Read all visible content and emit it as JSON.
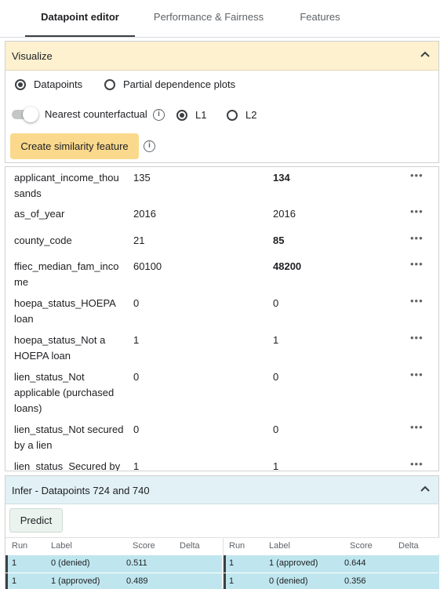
{
  "tabs": [
    {
      "label": "Datapoint editor"
    },
    {
      "label": "Performance & Fairness"
    },
    {
      "label": "Features"
    }
  ],
  "visualize": {
    "title": "Visualize",
    "radio_datapoints": "Datapoints",
    "radio_pdp": "Partial dependence plots",
    "nearest_label": "Nearest counterfactual",
    "l1": "L1",
    "l2": "L2",
    "similarity_button": "Create similarity feature"
  },
  "features": [
    {
      "name": "applicant_income_thousands",
      "v1": "135",
      "v2": "134",
      "v2_bold": true
    },
    {
      "name": "as_of_year",
      "v1": "2016",
      "v2": "2016",
      "v2_bold": false
    },
    {
      "name": "county_code",
      "v1": "21",
      "v2": "85",
      "v2_bold": true
    },
    {
      "name": "ffiec_median_fam_income",
      "v1": "60100",
      "v2": "48200",
      "v2_bold": true
    },
    {
      "name": "hoepa_status_HOEPA loan",
      "v1": "0",
      "v2": "0",
      "v2_bold": false
    },
    {
      "name": "hoepa_status_Not a HOEPA loan",
      "v1": "1",
      "v2": "1",
      "v2_bold": false
    },
    {
      "name": "lien_status_Not applicable (purchased loans)",
      "v1": "0",
      "v2": "0",
      "v2_bold": false
    },
    {
      "name": "lien_status_Not secured by a lien",
      "v1": "0",
      "v2": "0",
      "v2_bold": false
    },
    {
      "name": "lien_status_Secured by",
      "v1": "1",
      "v2": "1",
      "v2_bold": false
    }
  ],
  "more_glyph": "•••",
  "infer": {
    "title": "Infer - Datapoints 724 and 740",
    "predict_button": "Predict",
    "headers": {
      "run": "Run",
      "label": "Label",
      "score": "Score",
      "delta": "Delta"
    },
    "left_rows": [
      {
        "run": "1",
        "label": "0 (denied)",
        "score": "0.511",
        "delta": ""
      },
      {
        "run": "1",
        "label": "1 (approved)",
        "score": "0.489",
        "delta": ""
      }
    ],
    "right_rows": [
      {
        "run": "1",
        "label": "1 (approved)",
        "score": "0.644",
        "delta": ""
      },
      {
        "run": "1",
        "label": "0 (denied)",
        "score": "0.356",
        "delta": ""
      }
    ]
  },
  "colors": {
    "visualize_header_bg": "#fdf1cf",
    "similarity_button_bg": "#fad98c",
    "infer_header_bg": "#e2f1f5",
    "result_row_bg": "#bfe6ee"
  },
  "icons": [
    "chevron-up-icon",
    "info-icon",
    "more-horiz-icon"
  ]
}
